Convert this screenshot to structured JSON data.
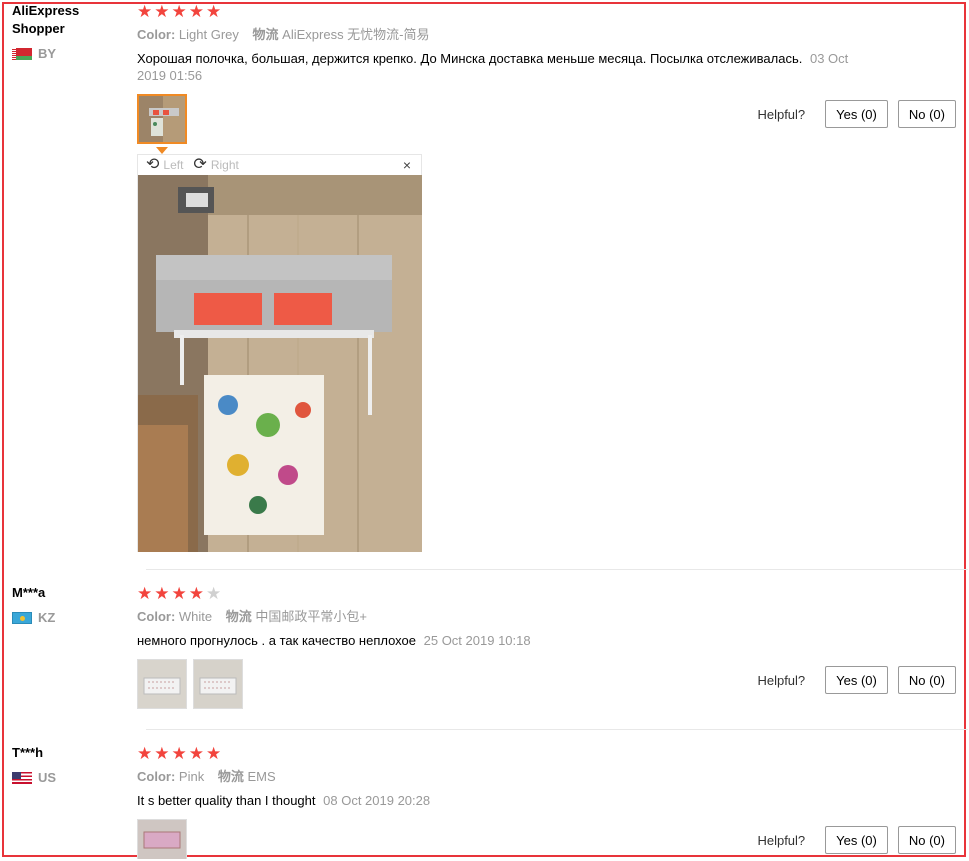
{
  "helpful_label": "Helpful?",
  "viewer": {
    "rotate_left": "Left",
    "rotate_right": "Right",
    "close": "×"
  },
  "colors": {
    "star": "#f2443d",
    "frame": "#e8343a",
    "active_thumb": "#f08a24"
  },
  "reviews": [
    {
      "user": "AliExpress Shopper",
      "country": "BY",
      "rating": 5,
      "color_key": "Color:",
      "color_value": "Light Grey",
      "logistics_key": "物流",
      "logistics_value": "AliExpress 无忧物流-简易",
      "text": "Хорошая полочка, большая, держится крепко. До Минска доставка меньше месяца. Посылка отслеживалась.",
      "date": "03 Oct 2019 01:56",
      "yes": "Yes (0)",
      "no": "No (0)"
    },
    {
      "user": "M***a",
      "country": "KZ",
      "rating": 4,
      "color_key": "Color:",
      "color_value": "White",
      "logistics_key": "物流",
      "logistics_value": "中国邮政平常小包+",
      "text": "немного прогнулось . а так качество неплохое",
      "date": "25 Oct 2019 10:18",
      "yes": "Yes (0)",
      "no": "No (0)"
    },
    {
      "user": "T***h",
      "country": "US",
      "rating": 5,
      "color_key": "Color:",
      "color_value": "Pink",
      "logistics_key": "物流",
      "logistics_value": "EMS",
      "text": "It s better quality than I thought",
      "date": "08 Oct 2019 20:28",
      "yes": "Yes (0)",
      "no": "No (0)"
    }
  ]
}
